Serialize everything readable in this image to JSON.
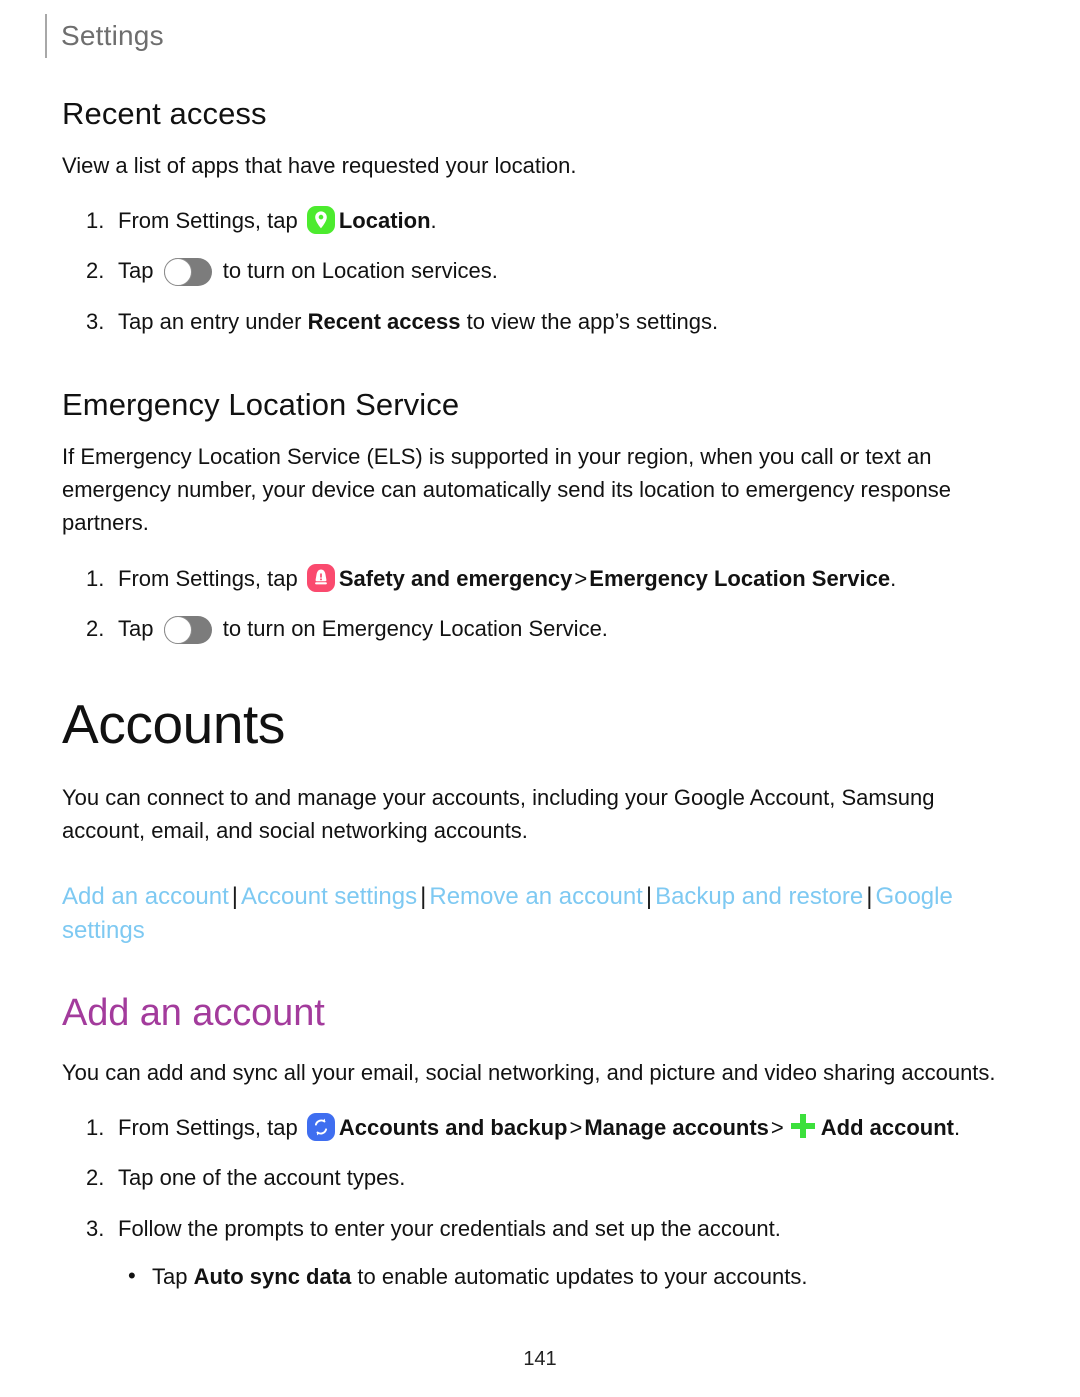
{
  "header": {
    "title": "Settings"
  },
  "recent_access": {
    "heading": "Recent access",
    "intro": "View a list of apps that have requested your location.",
    "steps": [
      {
        "num": "1.",
        "pre": "From Settings, tap ",
        "icon": "location-icon",
        "bold": "Location",
        "post": "."
      },
      {
        "num": "2.",
        "pre": "Tap ",
        "icon": "toggle-switch",
        "post": " to turn on Location services."
      },
      {
        "num": "3.",
        "pre": "Tap an entry under ",
        "bold": "Recent access",
        "post": " to view the app’s settings."
      }
    ]
  },
  "emergency_location_service": {
    "heading": "Emergency Location Service",
    "intro": "If Emergency Location Service (ELS) is supported in your region, when you call or text an emergency number, your device can automatically send its location to emergency response partners.",
    "steps": [
      {
        "num": "1.",
        "pre": "From Settings, tap ",
        "icon": "safety-and-emergency-icon",
        "bold": "Safety and emergency",
        "chevron": ">",
        "bold2": "Emergency Location Service",
        "post": "."
      },
      {
        "num": "2.",
        "pre": "Tap ",
        "icon": "toggle-switch",
        "post": " to turn on Emergency Location Service."
      }
    ]
  },
  "accounts": {
    "title": "Accounts",
    "intro": "You can connect to and manage your accounts, including your Google Account, Samsung account, email, and social networking accounts.",
    "links": [
      "Add an account",
      "Account settings",
      "Remove an account",
      "Backup and restore",
      "Google settings"
    ],
    "link_separator": "|"
  },
  "add_an_account": {
    "heading": "Add an account",
    "intro": "You can add and sync all your email, social networking, and picture and video sharing accounts.",
    "steps": [
      {
        "num": "1.",
        "pre": "From Settings, tap ",
        "icon": "accounts-and-backup-icon",
        "bold": "Accounts and backup",
        "chevron": ">",
        "bold2": "Manage accounts",
        "chevron2": ">",
        "icon2": "plus-icon",
        "bold3": "Add account",
        "post": "."
      },
      {
        "num": "2.",
        "text": "Tap one of the account types."
      },
      {
        "num": "3.",
        "text": "Follow the prompts to enter your credentials and set up the account."
      }
    ],
    "bullet": {
      "dot": "•",
      "pre": "Tap ",
      "bold": "Auto sync data",
      "post": " to enable automatic updates to your accounts."
    }
  },
  "footer": {
    "page_number": "141"
  },
  "colors": {
    "location_icon": "#4ceb2e",
    "safety_icon": "#fa4a6e",
    "accounts_icon": "#3f6ef0",
    "plus_icon": "#3ce03c",
    "section_heading": "#a33b9c",
    "link": "#7ec9f2",
    "toggle_track": "#7c7c7c"
  }
}
